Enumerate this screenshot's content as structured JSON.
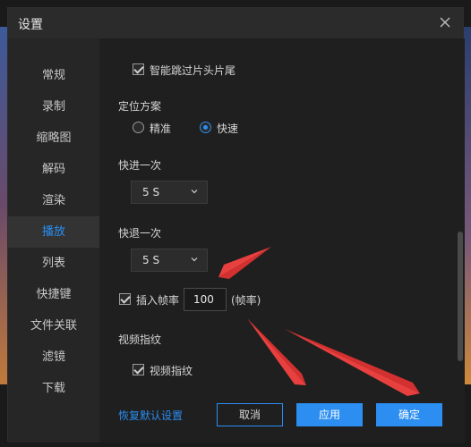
{
  "dialog": {
    "title": "设置",
    "close_icon": "close-icon"
  },
  "sidebar": {
    "items": [
      {
        "label": "常规"
      },
      {
        "label": "录制"
      },
      {
        "label": "缩略图"
      },
      {
        "label": "解码"
      },
      {
        "label": "渲染"
      },
      {
        "label": "播放",
        "active": true
      },
      {
        "label": "列表"
      },
      {
        "label": "快捷键"
      },
      {
        "label": "文件关联"
      },
      {
        "label": "滤镜"
      },
      {
        "label": "下载"
      }
    ]
  },
  "playback": {
    "skip_intro_outro": {
      "label": "智能跳过片头片尾",
      "checked": true
    },
    "positioning": {
      "heading": "定位方案",
      "options": [
        {
          "label": "精准",
          "selected": false
        },
        {
          "label": "快速",
          "selected": true
        }
      ]
    },
    "fast_forward": {
      "heading": "快进一次",
      "value": "5 S"
    },
    "fast_rewind": {
      "heading": "快退一次",
      "value": "5 S"
    },
    "insert_frames": {
      "label": "插入帧率",
      "checked": true,
      "value": "100",
      "unit": "(帧率)"
    },
    "video_fingerprint": {
      "heading": "视频指纹",
      "label": "视频指纹",
      "checked": true
    }
  },
  "footer": {
    "restore_defaults": "恢复默认设置",
    "cancel": "取消",
    "apply": "应用",
    "ok": "确定"
  },
  "colors": {
    "accent": "#2b8ef0",
    "annotation_arrow": "#e8403f"
  }
}
